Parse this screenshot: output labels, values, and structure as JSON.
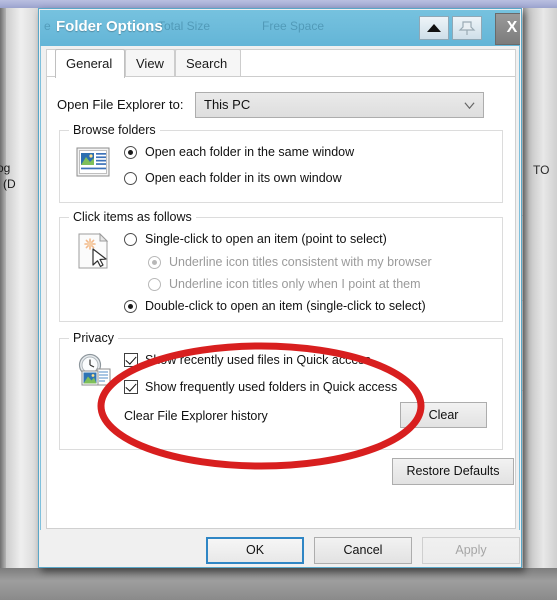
{
  "background": {
    "column_headers": [
      "Total Size",
      "Free Space"
    ],
    "left_fragment_1": "og",
    "left_fragment_2": "(D",
    "right_fragment": "TO",
    "left_edge_fragment": "e"
  },
  "dialog": {
    "title": "Folder Options",
    "titlebar_buttons": [
      {
        "name": "up-arrow-button",
        "glyph": "▲"
      },
      {
        "name": "pin-button",
        "glyph": "⚑"
      },
      {
        "name": "close-button",
        "label": "X"
      }
    ]
  },
  "tabs": [
    {
      "label": "General",
      "active": true
    },
    {
      "label": "View",
      "active": false
    },
    {
      "label": "Search",
      "active": false
    }
  ],
  "open_explorer_to": {
    "label": "Open File Explorer to:",
    "value": "This PC",
    "icon": "chevron-down-icon"
  },
  "browse_folders": {
    "title": "Browse folders",
    "icon": "window-preview-icon",
    "options": [
      {
        "label": "Open each folder in the same window",
        "checked": true
      },
      {
        "label": "Open each folder in its own window",
        "checked": false
      }
    ]
  },
  "click_items": {
    "title": "Click items as follows",
    "icon": "page-cursor-icon",
    "options": [
      {
        "label": "Single-click to open an item (point to select)",
        "checked": false,
        "disabled": false,
        "indent": false
      },
      {
        "label": "Underline icon titles consistent with my browser",
        "checked": true,
        "disabled": true,
        "indent": true
      },
      {
        "label": "Underline icon titles only when I point at them",
        "checked": false,
        "disabled": true,
        "indent": true
      },
      {
        "label": "Double-click to open an item (single-click to select)",
        "checked": true,
        "disabled": false,
        "indent": false
      }
    ]
  },
  "privacy": {
    "title": "Privacy",
    "icon": "clock-history-icon",
    "checkboxes": [
      {
        "label": "Show recently used files in Quick access",
        "checked": true
      },
      {
        "label": "Show frequently used folders in Quick access",
        "checked": true
      }
    ],
    "clear_history_label": "Clear File Explorer history",
    "clear_button": "Clear"
  },
  "restore_defaults_button": "Restore Defaults",
  "footer": {
    "ok": "OK",
    "cancel": "Cancel",
    "apply": "Apply",
    "apply_disabled": true
  },
  "annotation": {
    "shape": "ellipse",
    "color": "#d81f1f",
    "stroke_width": 7
  }
}
